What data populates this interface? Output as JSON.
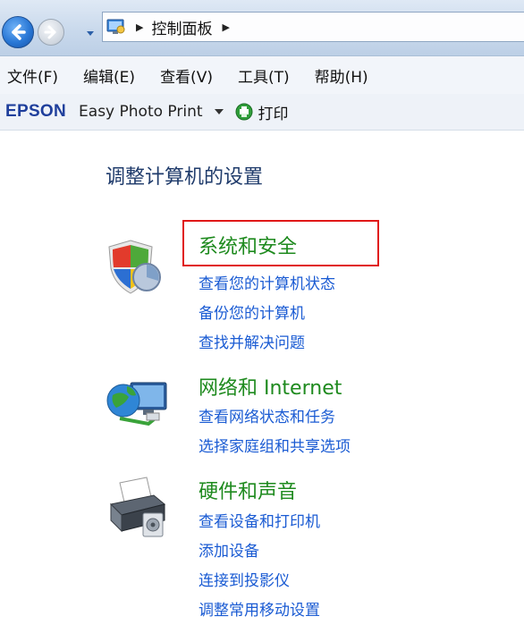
{
  "address_bar": {
    "breadcrumb": "控制面板"
  },
  "menu": {
    "items": [
      "文件(F)",
      "编辑(E)",
      "查看(V)",
      "工具(T)",
      "帮助(H)"
    ]
  },
  "toolbar": {
    "brand": "EPSON",
    "app": "Easy Photo Print",
    "print": "打印"
  },
  "content": {
    "title": "调整计算机的设置",
    "categories": [
      {
        "title": "系统和安全",
        "icon": "shield-icon",
        "links": [
          "查看您的计算机状态",
          "备份您的计算机",
          "查找并解决问题"
        ]
      },
      {
        "title": "网络和 Internet",
        "icon": "network-globe-icon",
        "links": [
          "查看网络状态和任务",
          "选择家庭组和共享选项"
        ]
      },
      {
        "title": "硬件和声音",
        "icon": "printer-icon",
        "links": [
          "查看设备和打印机",
          "添加设备",
          "连接到投影仪",
          "调整常用移动设置"
        ]
      }
    ]
  },
  "colors": {
    "category_title": "#1e8a1e",
    "link": "#1a5bd3",
    "highlight_box": "#e01818"
  }
}
